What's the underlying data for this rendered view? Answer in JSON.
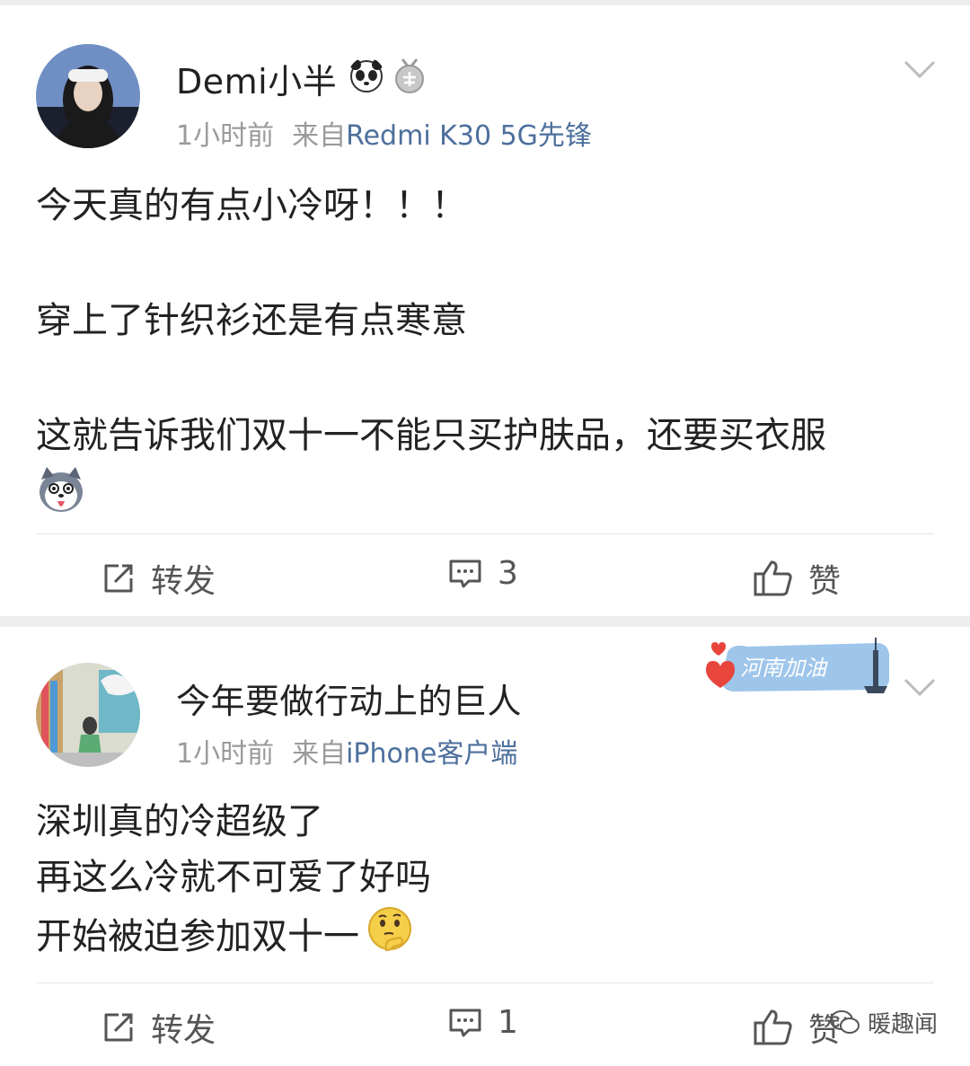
{
  "posts": [
    {
      "username": "Demi小半",
      "time": "1小时前",
      "from_label": "来自",
      "device": "Redmi K30 5G先锋",
      "paragraphs": [
        "今天真的有点小冷呀！！！",
        "穿上了针织衫还是有点寒意",
        "这就告诉我们双十一不能只买护肤品，还要买衣服"
      ],
      "emoji_icon": "husky-dog-emoji-icon",
      "actions": {
        "repost": "转发",
        "comment": "3",
        "like": "赞"
      }
    },
    {
      "username": "今年要做行动上的巨人",
      "time": "1小时前",
      "from_label": "来自",
      "device": "iPhone客户端",
      "event_badge": "河南加油",
      "paragraphs": [
        "深圳真的冷超级了",
        "再这么冷就不可爱了好吗",
        "开始被迫参加双十一"
      ],
      "emoji_icon": "thinking-face-emoji-icon",
      "actions": {
        "repost": "转发",
        "comment": "1",
        "like": "赞"
      }
    }
  ],
  "watermark": "暖趣闻",
  "colors": {
    "link": "#4d6f9c",
    "meta": "#9a9a9a",
    "text": "#222222",
    "divider": "#eeeeee"
  }
}
